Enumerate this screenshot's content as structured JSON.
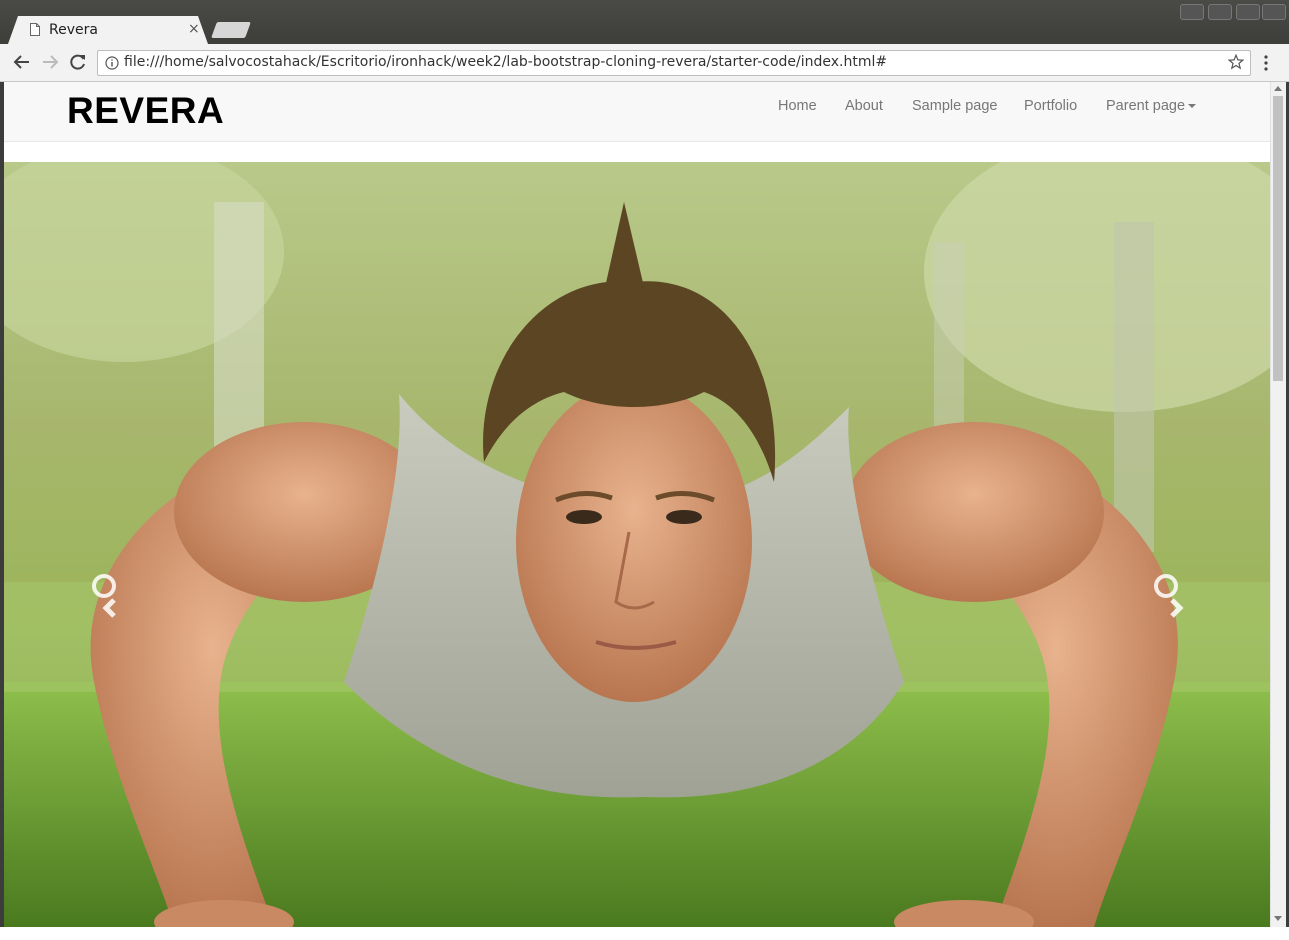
{
  "browser": {
    "tab_title": "Revera",
    "tab_close_glyph": "×",
    "url": "file:///home/salvocostahack/Escritorio/ironhack/week2/lab-bootstrap-cloning-revera/starter-code/index.html#",
    "icons": [
      "page-icon",
      "close-icon",
      "back-arrow-icon",
      "forward-arrow-icon",
      "reload-icon",
      "info-icon",
      "star-icon",
      "menu-dots-icon"
    ]
  },
  "site": {
    "brand": "REVERA",
    "nav": {
      "home": "Home",
      "about": "About",
      "sample": "Sample page",
      "portfolio": "Portfolio",
      "parent": "Parent page"
    },
    "carousel_icons": [
      "chevron-left-icon",
      "chevron-right-icon"
    ]
  },
  "colors": {
    "navbar_bg": "#f8f8f8",
    "nav_text": "#777777",
    "brand_text": "#000000"
  }
}
